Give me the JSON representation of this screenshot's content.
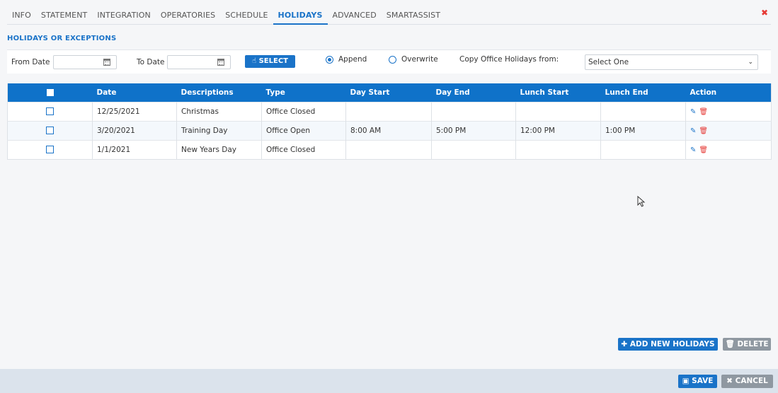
{
  "tabs": [
    {
      "label": "INFO"
    },
    {
      "label": "STATEMENT"
    },
    {
      "label": "INTEGRATION"
    },
    {
      "label": "OPERATORIES"
    },
    {
      "label": "SCHEDULE"
    },
    {
      "label": "HOLIDAYS",
      "active": true
    },
    {
      "label": "ADVANCED"
    },
    {
      "label": "SMARTASSIST"
    }
  ],
  "close_symbol": "✖",
  "section_title": "HOLIDAYS OR EXCEPTIONS",
  "filter": {
    "from_label": "From Date",
    "from_value": "",
    "to_label": "To Date",
    "to_value": "",
    "select_label": "SELECT",
    "append_label": "Append",
    "overwrite_label": "Overwrite",
    "mode_selected": "Append",
    "copy_label": "Copy Office Holidays from:",
    "copy_selected": "Select One"
  },
  "table": {
    "columns": [
      "Date",
      "Descriptions",
      "Type",
      "Day Start",
      "Day End",
      "Lunch Start",
      "Lunch End",
      "Action"
    ],
    "rows": [
      {
        "date": "12/25/2021",
        "description": "Christmas",
        "type": "Office Closed",
        "day_start": "",
        "day_end": "",
        "lunch_start": "",
        "lunch_end": ""
      },
      {
        "date": "3/20/2021",
        "description": "Training Day",
        "type": "Office Open",
        "day_start": "8:00 AM",
        "day_end": "5:00 PM",
        "lunch_start": "12:00 PM",
        "lunch_end": "1:00 PM"
      },
      {
        "date": "1/1/2021",
        "description": "New Years Day",
        "type": "Office Closed",
        "day_start": "",
        "day_end": "",
        "lunch_start": "",
        "lunch_end": ""
      }
    ]
  },
  "buttons": {
    "add_new_holidays": "ADD NEW HOLIDAYS",
    "delete": "DELETE",
    "save": "SAVE",
    "cancel": "CANCEL"
  },
  "colors": {
    "accent": "#1a73c8",
    "header_bg": "#0f72c9",
    "danger": "#e53935",
    "secondary_btn": "#8f98a1",
    "footer_bg": "#dbe3ec"
  }
}
